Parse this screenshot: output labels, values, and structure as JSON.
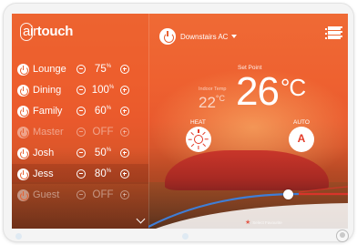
{
  "app": {
    "logo_air": "air",
    "logo_touch": "touch"
  },
  "header": {
    "ac_name": "Downstairs AC"
  },
  "zones": [
    {
      "name": "Lounge",
      "value": "75",
      "unit": "%",
      "state": "on",
      "selected": false
    },
    {
      "name": "Dining",
      "value": "100",
      "unit": "%",
      "state": "on",
      "selected": false
    },
    {
      "name": "Family",
      "value": "60",
      "unit": "%",
      "state": "on",
      "selected": false
    },
    {
      "name": "Master",
      "value": "OFF",
      "unit": "",
      "state": "off",
      "selected": false
    },
    {
      "name": "Josh",
      "value": "50",
      "unit": "%",
      "state": "on",
      "selected": false
    },
    {
      "name": "Jess",
      "value": "80",
      "unit": "%",
      "state": "on",
      "selected": true
    },
    {
      "name": "Guest",
      "value": "OFF",
      "unit": "",
      "state": "off",
      "selected": false
    }
  ],
  "climate": {
    "setpoint_label": "Set Point",
    "setpoint_value": "26",
    "setpoint_unit": "°C",
    "indoor_label": "Indoor Temp",
    "indoor_value": "22",
    "indoor_unit": "°C"
  },
  "modes": {
    "heat_label": "HEAT",
    "auto_label": "AUTO",
    "auto_icon_text": "A"
  },
  "slider": {
    "level": 0.7
  },
  "footer": {
    "favourites_label": "Select Favourite"
  },
  "colors": {
    "accent": "#e86030",
    "icon_red": "#e33b28",
    "slider_blue": "#3f7ed6",
    "slider_red": "#d8342b"
  }
}
